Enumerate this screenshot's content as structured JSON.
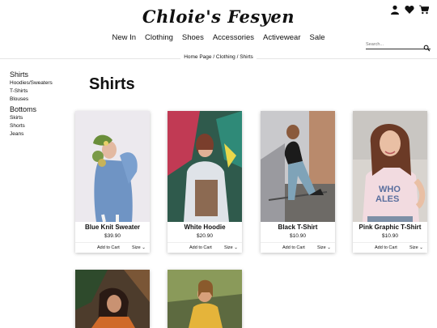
{
  "brand": {
    "logo": "Chloie's Fesyen"
  },
  "nav": {
    "items": [
      "New In",
      "Clothing",
      "Shoes",
      "Accessories",
      "Activewear",
      "Sale"
    ]
  },
  "search": {
    "placeholder": "Search..."
  },
  "breadcrumb": {
    "text": "Home Page / Clothing / Shirts"
  },
  "sidebar": {
    "group1": "Shirts",
    "group1_items": [
      "Hoodies/Sweaters",
      "T-Shirts",
      "Blouses"
    ],
    "group2": "Bottoms",
    "group2_items": [
      "Skirts",
      "Shorts",
      "Jeans"
    ]
  },
  "page": {
    "title": "Shirts"
  },
  "products": [
    {
      "name": "Blue Knit Sweater",
      "price": "$39.90",
      "add": "Add to Cart",
      "size": "Size"
    },
    {
      "name": "White Hoodie",
      "price": "$20.90",
      "add": "Add to Cart",
      "size": "Size"
    },
    {
      "name": "Black T-Shirt",
      "price": "$10.90",
      "add": "Add to Cart",
      "size": "Size"
    },
    {
      "name": "Pink Graphic T-Shirt",
      "price": "$10.90",
      "add": "Add to Cart",
      "size": "Size"
    }
  ],
  "photo_text": {
    "tee_print": "WHO\nALES"
  },
  "icons": [
    "user-icon",
    "heart-icon",
    "cart-icon",
    "search-icon",
    "chevron-down-icon"
  ]
}
